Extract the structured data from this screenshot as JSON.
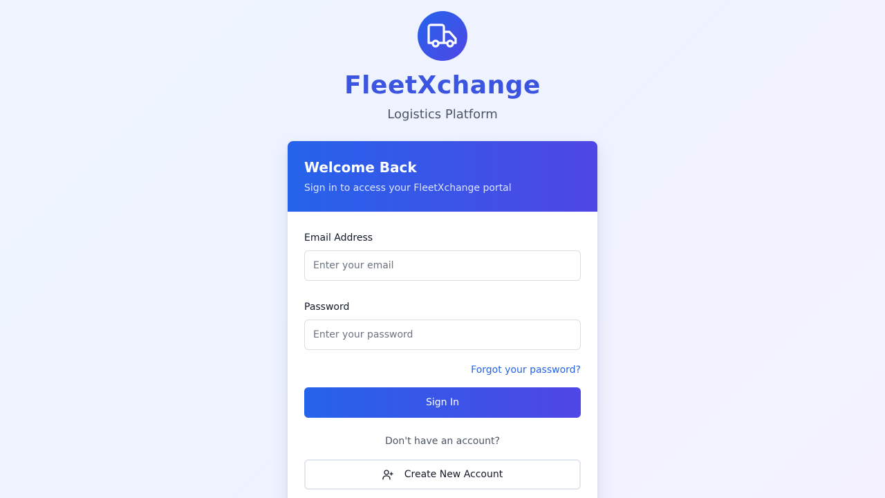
{
  "brand": {
    "logo_icon": "truck-icon",
    "title": "FleetXchange",
    "subtitle": "Logistics Platform"
  },
  "login_card": {
    "title": "Welcome Back",
    "subtitle": "Sign in to access your FleetXchange portal",
    "email": {
      "label": "Email Address",
      "placeholder": "Enter your email",
      "value": ""
    },
    "password": {
      "label": "Password",
      "placeholder": "Enter your password",
      "value": ""
    },
    "forgot_password_label": "Forgot your password?",
    "sign_in_label": "Sign In",
    "no_account_text": "Don't have an account?",
    "create_account": {
      "label": "Create New Account",
      "icon": "user-plus-icon"
    }
  },
  "colors": {
    "brand_primary": "#2563eb",
    "brand_secondary": "#4f46e5",
    "title_color": "#3b55e0",
    "link_color": "#2563eb"
  }
}
